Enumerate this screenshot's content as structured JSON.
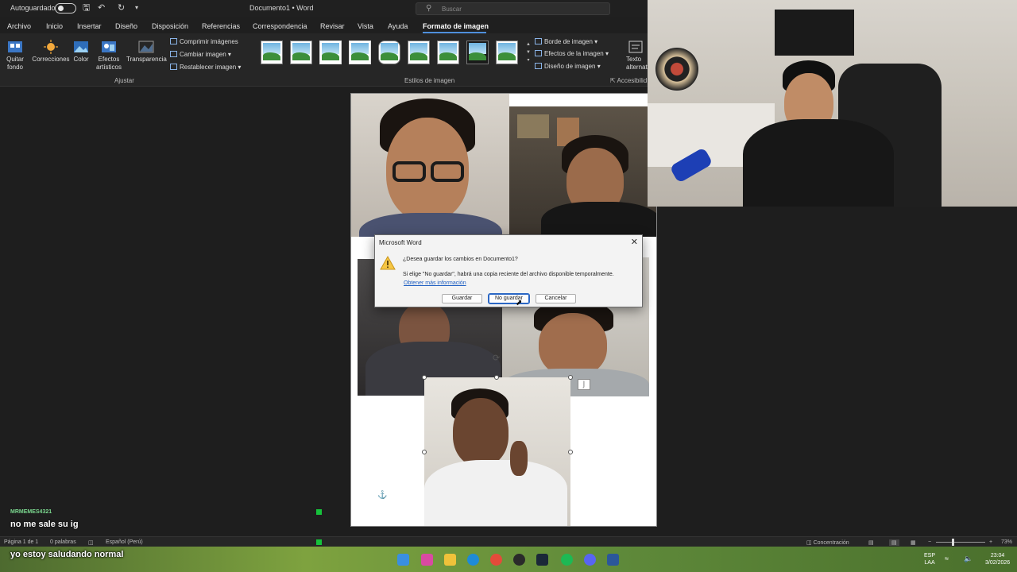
{
  "window": {
    "autosave_label": "Autoguardado",
    "doc_title": "Documento1 • Word",
    "search_placeholder": "Buscar"
  },
  "ribbon_tabs": [
    "Archivo",
    "Inicio",
    "Insertar",
    "Diseño",
    "Disposición",
    "Referencias",
    "Correspondencia",
    "Revisar",
    "Vista",
    "Ayuda",
    "Formato de imagen"
  ],
  "ribbon": {
    "adjust": {
      "remove_bg": "Quitar fondo",
      "corrections": "Correcciones",
      "color": "Color",
      "artistic": "Efectos artísticos",
      "transparency": "Transparencia",
      "compress": "Comprimir imágenes",
      "change": "Cambiar imagen",
      "reset": "Restablecer imagen",
      "group_label": "Ajustar"
    },
    "styles": {
      "group_label": "Estilos de imagen",
      "border": "Borde de imagen",
      "effects": "Efectos de la imagen",
      "layout": "Diseño de imagen"
    },
    "accessibility": {
      "alt_text": "Texto alternativ",
      "group_label": "Accesibilid"
    }
  },
  "dialog": {
    "title": "Microsoft Word",
    "question": "¿Desea guardar los cambios en Documento1?",
    "info": "Si elige \"No guardar\", habrá una copia reciente del archivo disponible temporalmente.",
    "link": "Obtener más información",
    "save": "Guardar",
    "dont_save": "No guardar",
    "cancel": "Cancelar"
  },
  "statusbar": {
    "page": "Página 1 de 1",
    "words": "0 palabras",
    "language": "Español (Perú)",
    "focus": "Concentración",
    "zoom": "73%"
  },
  "taskbar": {
    "lang": "ESP",
    "lang2": "LAA",
    "time": "23:04",
    "date": "3/02/2026"
  },
  "chat": {
    "user": "MRMEMES4321",
    "msg1": "no me sale su ig",
    "msg2": "yo estoy saludando normal"
  }
}
